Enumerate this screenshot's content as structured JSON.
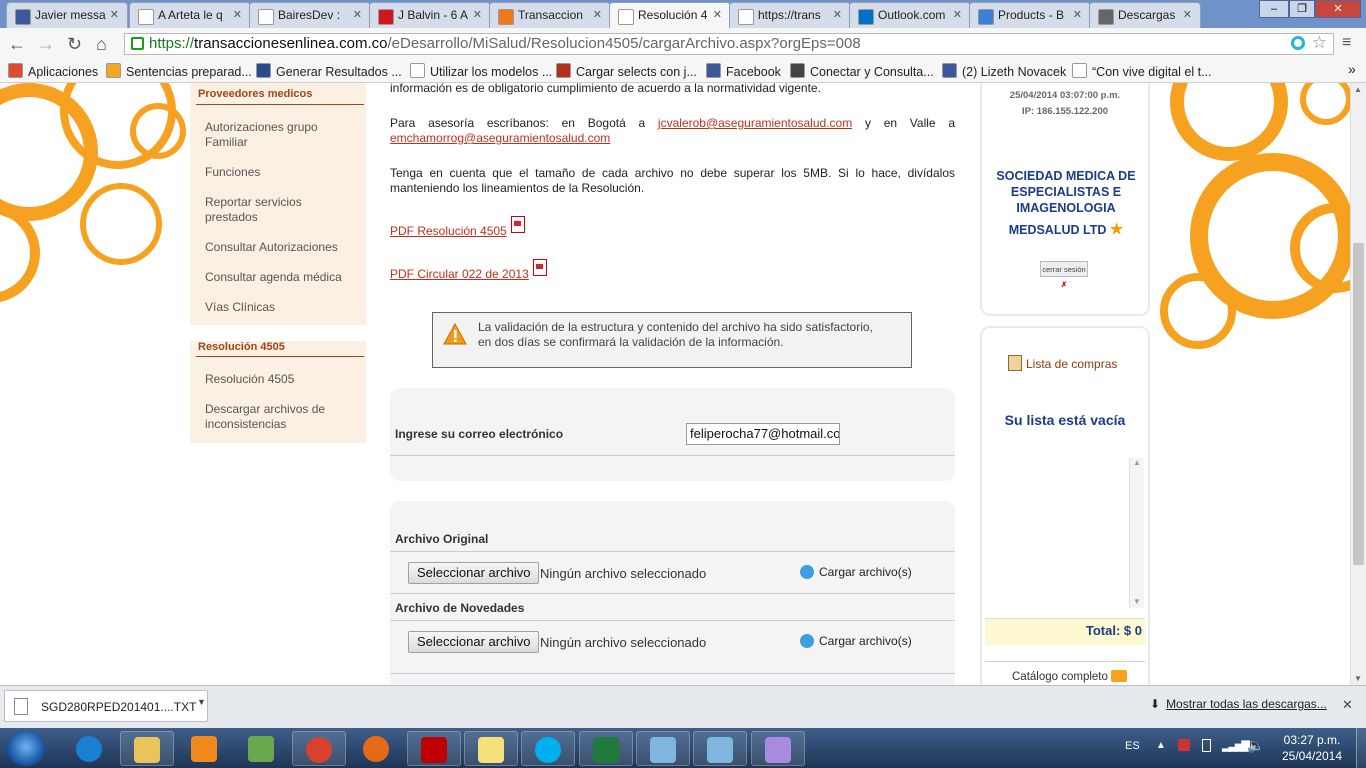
{
  "browser": {
    "tabs": [
      {
        "label": "Javier messa",
        "color": "#3b5998"
      },
      {
        "label": "A Arteta le q",
        "color": "#ffffff"
      },
      {
        "label": "BairesDev : ",
        "color": "#ffffff"
      },
      {
        "label": "J Balvin - 6 A",
        "color": "#cc181e"
      },
      {
        "label": "Transaccion",
        "color": "#f07a1a"
      },
      {
        "label": "Resolución 4",
        "color": "#ffffff"
      },
      {
        "label": "https://trans",
        "color": "#ffffff"
      },
      {
        "label": "Outlook.com",
        "color": "#0072c6"
      },
      {
        "label": "Products - B",
        "color": "#3a7fd8"
      },
      {
        "label": "Descargas",
        "color": "#666666"
      }
    ],
    "window_controls": {
      "minimize": "–",
      "maximize": "❐",
      "close": "✕"
    },
    "url_prefix": "https://",
    "url_host": "transaccionesenlinea.com.co",
    "url_path": "/eDesarrollo/MiSalud/Resolucion4505/cargarArchivo.aspx?orgEps=008",
    "bookmarks": [
      {
        "label": "Aplicaciones",
        "color": "#e04b2f"
      },
      {
        "label": "Sentencias preparad...",
        "color": "#f5a623"
      },
      {
        "label": "Generar Resultados ...",
        "color": "#2a4c8c"
      },
      {
        "label": "Utilizar los modelos ...",
        "color": "#ffffff"
      },
      {
        "label": "Cargar selects con j...",
        "color": "#b3301a"
      },
      {
        "label": "Facebook",
        "color": "#3b5998"
      },
      {
        "label": "Conectar y Consulta...",
        "color": "#444444"
      },
      {
        "label": "(2) Lizeth Novacek",
        "color": "#3b5998"
      },
      {
        "label": "“Con vive digital el t...",
        "color": "#ffffff"
      }
    ],
    "bookmarks_more": "»"
  },
  "sidebar": {
    "section1_title": "Proveedores medicos",
    "section1_items": [
      "Autorizaciones grupo Familiar",
      "Funciones",
      "Reportar servicios prestados",
      "Consultar Autorizaciones",
      "Consultar agenda médica",
      "Vías Clínicas"
    ],
    "section2_title": "Resolución 4505",
    "section2_items": [
      "Resolución 4505",
      "Descargar archivos de inconsistencias"
    ]
  },
  "main": {
    "intro_partial": "información es de obligatorio cumplimiento de acuerdo a la normatividad vigente.",
    "asesoria_prefix": "Para asesoría escríbanos: en Bogotá a",
    "email_bogota": "jcvalerob@aseguramientosalud.com",
    "asesoria_middle": "y en Valle a",
    "email_valle": "emchamorrog@aseguramientosalud.com",
    "size_note": "Tenga en cuenta que el tamaño de cada archivo no debe superar los 5MB. Si lo hace, divídalos manteniendo los lineamientos de la Resolución.",
    "pdf1": "PDF Resolución 4505",
    "pdf2": "PDF Circular 022 de 2013",
    "alert_line1": "La validación de la estructura y contenido del archivo ha sido satisfactorio,",
    "alert_line2": "en dos días se confirmará la validación de la información.",
    "email_label": "Ingrese su correo electrónico",
    "email_value": "feliperocha77@hotmail.co",
    "upload_rows": [
      {
        "title": "Archivo Original",
        "button": "Seleccionar archivo",
        "status": "Ningún archivo seleccionado",
        "action": "Cargar archivo(s)"
      },
      {
        "title": "Archivo de Novedades",
        "button": "Seleccionar archivo",
        "status": "Ningún archivo seleccionado",
        "action": "Cargar archivo(s)"
      }
    ]
  },
  "right": {
    "datetime": "25/04/2014 03:07:00 p.m.",
    "ip": "IP: 186.155.122.200",
    "company": "SOCIEDAD MEDICA DE ESPECIALISTAS E IMAGENOLOGIA",
    "company2": "MEDSALUD LTD",
    "logout": "cerrar sesión",
    "cart_title": "Lista de compras",
    "cart_empty": "Su lista está vacía",
    "total": "Total: $ 0",
    "catalog": "Catálogo completo"
  },
  "downloads": {
    "file": "SGD280RPED201401....TXT",
    "show_all": "Mostrar todas las descargas...",
    "close": "✕"
  },
  "taskbar": {
    "lang": "ES",
    "time": "03:27 p.m.",
    "date": "25/04/2014",
    "apps": [
      {
        "name": "ie",
        "color": "#1b7fd1",
        "open": false
      },
      {
        "name": "explorer",
        "color": "#e8c45a",
        "open": true
      },
      {
        "name": "media-player",
        "color": "#f08a1c",
        "open": false
      },
      {
        "name": "people",
        "color": "#6aa84f",
        "open": false
      },
      {
        "name": "chrome",
        "color": "#d9412f",
        "open": true
      },
      {
        "name": "firefox",
        "color": "#e66b17",
        "open": false
      },
      {
        "name": "filezilla",
        "color": "#bf0000",
        "open": true
      },
      {
        "name": "sticky-notes",
        "color": "#f3e27a",
        "open": true
      },
      {
        "name": "skype",
        "color": "#00aff0",
        "open": true
      },
      {
        "name": "excel",
        "color": "#1f7a3c",
        "open": true
      },
      {
        "name": "notes-app",
        "color": "#7fb6e0",
        "open": true
      },
      {
        "name": "notes-app-2",
        "color": "#7fb6e0",
        "open": true
      },
      {
        "name": "paint",
        "color": "#a88be0",
        "open": true
      }
    ]
  }
}
